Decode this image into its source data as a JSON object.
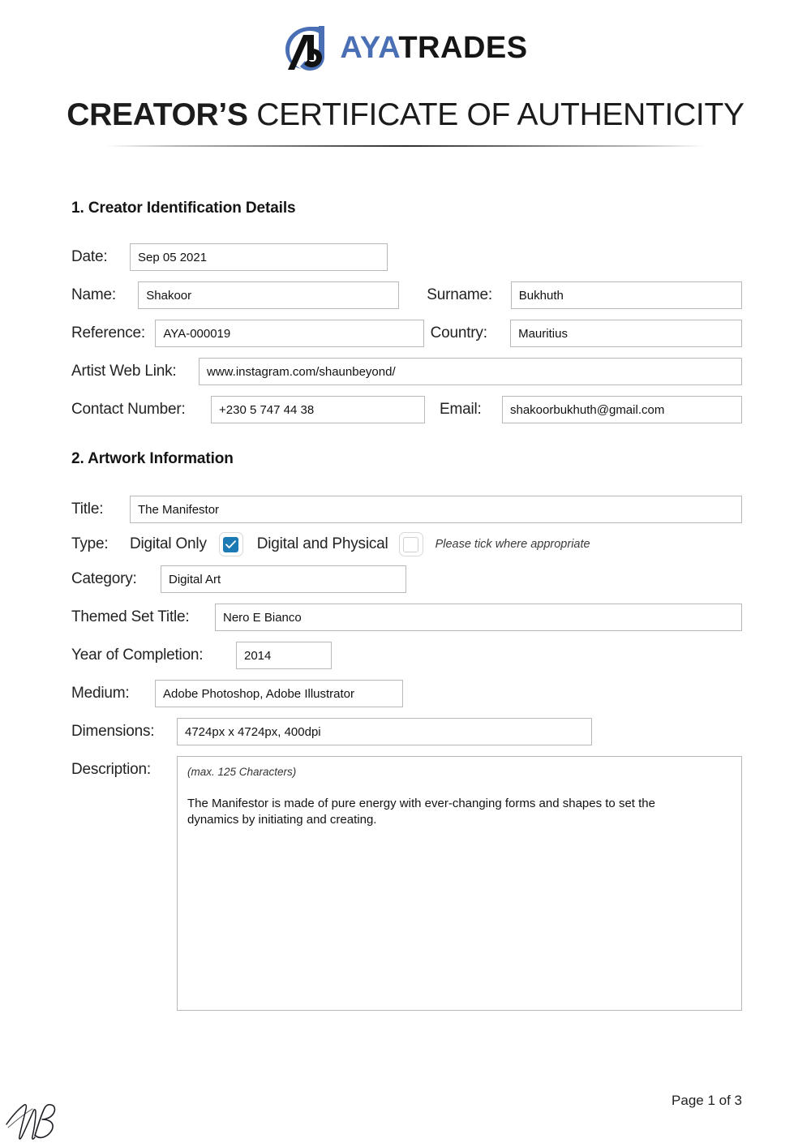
{
  "brand": {
    "logo_icon": "ayatrades-a-mark-icon",
    "name_part1": "AYA",
    "name_part2": "TRADES",
    "blue": "#4a6fb5",
    "black": "#151515"
  },
  "document": {
    "title_strong": "CREATOR’S",
    "title_light": "CERTIFICATE OF AUTHENTICITY"
  },
  "section1": {
    "heading": "1. Creator Identification Details",
    "date": {
      "label": "Date:",
      "value": "Sep 05 2021"
    },
    "name": {
      "label": "Name:",
      "value": "Shakoor"
    },
    "surname": {
      "label": "Surname:",
      "value": "Bukhuth"
    },
    "reference": {
      "label": "Reference:",
      "value": "AYA-000019"
    },
    "country": {
      "label": "Country:",
      "value": "Mauritius"
    },
    "web_link": {
      "label": "Artist Web Link:",
      "value": "www.instagram.com/shaunbeyond/"
    },
    "contact": {
      "label": "Contact Number:",
      "value": "+230 5 747 44 38"
    },
    "email": {
      "label": "Email:",
      "value": "shakoorbukhuth@gmail.com"
    }
  },
  "section2": {
    "heading": "2. Artwork Information",
    "title": {
      "label": "Title:",
      "value": "The Manifestor"
    },
    "type": {
      "label": "Type:",
      "option1_label": "Digital Only",
      "option1_checked": true,
      "option2_label": "Digital and Physical",
      "option2_checked": false,
      "hint": "Please tick where appropriate",
      "checked_color": "#1b7ab4"
    },
    "category": {
      "label": "Category:",
      "value": "Digital Art"
    },
    "themed_set_title": {
      "label": "Themed Set Title:",
      "value": "Nero E Bianco"
    },
    "year_of_completion": {
      "label": "Year of Completion:",
      "value": "2014"
    },
    "medium": {
      "label": "Medium:",
      "value": "Adobe Photoshop, Adobe Illustrator"
    },
    "dimensions": {
      "label": "Dimensions:",
      "value": "4724px x 4724px, 400dpi"
    },
    "description": {
      "label": "Description:",
      "hint": "(max. 125 Characters)",
      "value": "The Manifestor is made of pure energy with ever-changing forms and shapes to set the dynamics by initiating and creating."
    }
  },
  "footer": {
    "page_number": "Page 1 of 3",
    "signature_icon": "handwritten-signature-nb"
  }
}
